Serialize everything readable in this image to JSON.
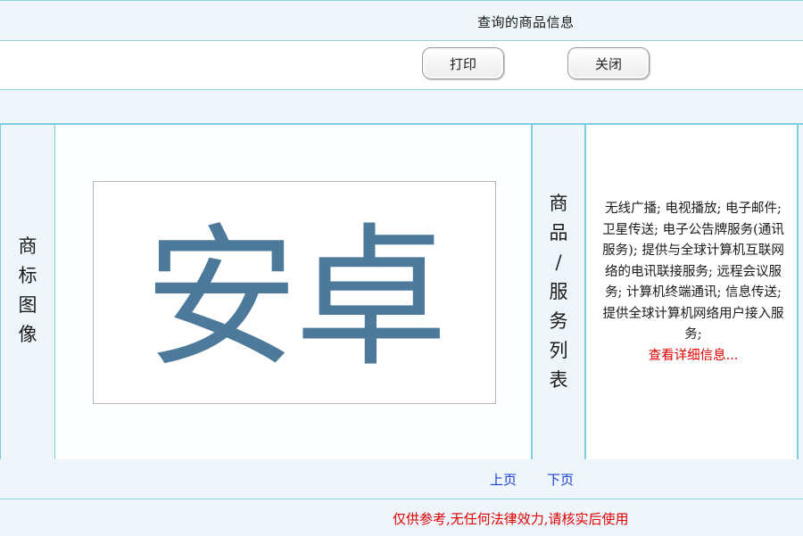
{
  "header": {
    "title": "查询的商品信息"
  },
  "toolbar": {
    "print_label": "打印",
    "close_label": "关闭"
  },
  "main": {
    "image_label": [
      "商",
      "标",
      "图",
      "像"
    ],
    "trademark_text": "安卓",
    "services_label": [
      "商",
      "品",
      "/",
      "服",
      "务",
      "列",
      "表"
    ],
    "services_text": "无线广播; 电视播放; 电子邮件; 卫星传送; 电子公告牌服务(通讯服务); 提供与全球计算机互联网络的电讯联接服务; 远程会议服务; 计算机终端通讯; 信息传送; 提供全球计算机网络用户接入服务;",
    "detail_link": "查看详细信息..."
  },
  "pagination": {
    "prev_label": "上页",
    "next_label": "下页"
  },
  "footer": {
    "disclaimer": "仅供参考,无任何法律效力,请核实后使用"
  },
  "colors": {
    "trademark_ink": "#4d7a9a",
    "link_red": "#e00000",
    "link_blue": "#1b3cd0",
    "border": "#7ccfe0"
  }
}
